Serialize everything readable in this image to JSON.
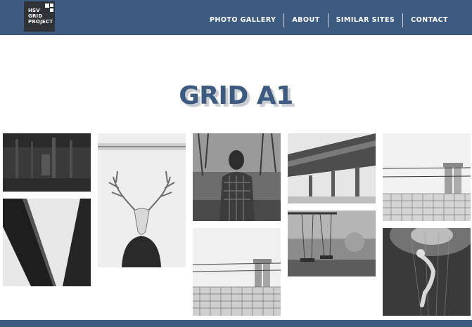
{
  "colors": {
    "brand": "#3d5a80"
  },
  "logo": {
    "lines": [
      "HSV",
      "GRID",
      "PROJECT"
    ]
  },
  "nav": {
    "items": [
      {
        "label": "PHOTO GALLERY"
      },
      {
        "label": "ABOUT"
      },
      {
        "label": "SIMILAR SITES"
      },
      {
        "label": "CONTACT"
      }
    ]
  },
  "page": {
    "title": "GRID A1"
  },
  "photos": [
    {
      "icon": "dark-corridor-photo"
    },
    {
      "icon": "overpass-from-below-photo"
    },
    {
      "icon": "deer-skull-portrait-photo"
    },
    {
      "icon": "man-in-flannel-photo"
    },
    {
      "icon": "fence-silos-photo"
    },
    {
      "icon": "bridge-underside-photo"
    },
    {
      "icon": "swings-photo"
    },
    {
      "icon": "barbed-wire-silos-photo"
    },
    {
      "icon": "underwater-figure-photo"
    }
  ]
}
